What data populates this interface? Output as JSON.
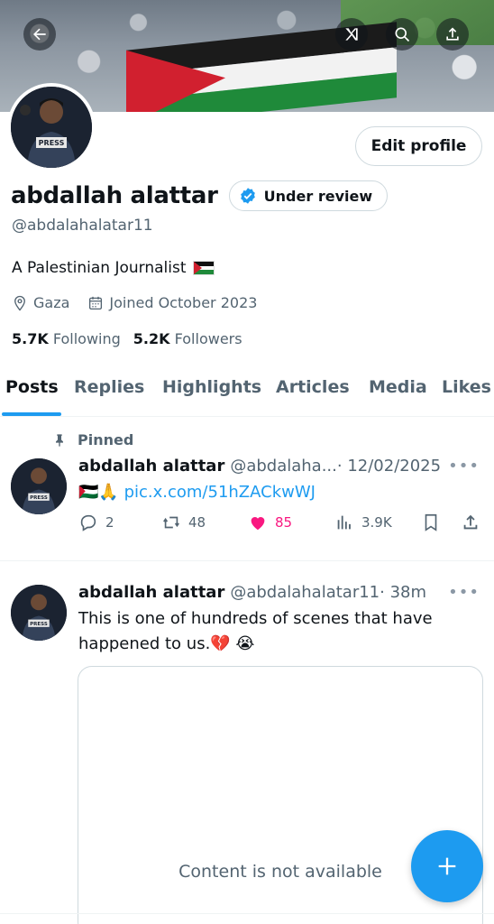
{
  "header": {
    "back_icon": "arrow-left-icon",
    "grok_icon": "grok-icon",
    "search_icon": "search-icon",
    "share_icon": "share-icon"
  },
  "profile": {
    "edit_label": "Edit profile",
    "name": "abdallah alattar",
    "badge_label": "Under review",
    "handle": "@abdalahalatar11",
    "bio": "A Palestinian Journalist",
    "location": "Gaza",
    "joined": "Joined October 2023",
    "following_count": "5.7K",
    "following_label": "Following",
    "followers_count": "5.2K",
    "followers_label": "Followers"
  },
  "tabs": [
    {
      "label": "Posts"
    },
    {
      "label": "Replies"
    },
    {
      "label": "Highlights"
    },
    {
      "label": "Articles"
    },
    {
      "label": "Media"
    },
    {
      "label": "Likes"
    }
  ],
  "posts": [
    {
      "pinned_label": "Pinned",
      "name": "abdallah alattar",
      "handle": "@abdalaha...",
      "time": "· 12/02/2025",
      "text_prefix": "🇵🇸🙏",
      "link": "pic.x.com/51hZACkwWJ",
      "replies": "2",
      "reposts": "48",
      "likes": "85",
      "views": "3.9K"
    },
    {
      "name": "abdallah alattar",
      "handle": "@abdalahalatar11",
      "time": "· 38m",
      "text": "This is one of hundreds of scenes that have happened to us.💔 😭",
      "media_message": "Content is not available"
    }
  ],
  "colors": {
    "accent": "#1d9bf0",
    "like": "#f91880",
    "muted": "#536471"
  }
}
